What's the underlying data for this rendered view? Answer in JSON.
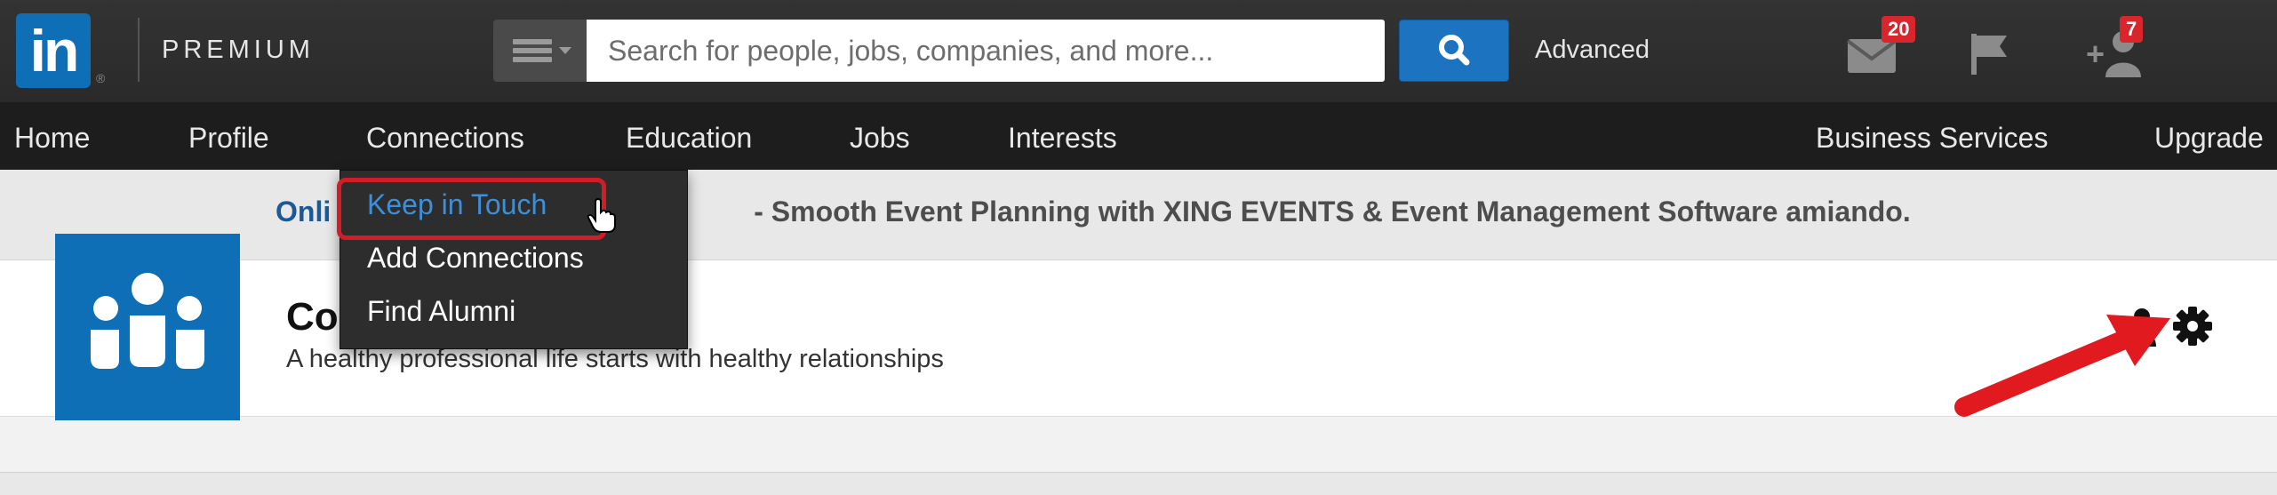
{
  "header": {
    "logo_text": "in",
    "logo_reg": "®",
    "brand_label": "PREMIUM",
    "search": {
      "placeholder": "Search for people, jobs, companies, and more..."
    },
    "advanced_label": "Advanced",
    "messages_count": "20",
    "notifications_count": "7"
  },
  "nav": {
    "items": [
      "Home",
      "Profile",
      "Connections",
      "Education",
      "Jobs",
      "Interests"
    ],
    "right_items": [
      "Business Services",
      "Upgrade"
    ]
  },
  "dropdown": {
    "items": [
      "Keep in Touch",
      "Add Connections",
      "Find Alumni"
    ]
  },
  "ad": {
    "link_text": "Onli",
    "rest_text": "- Smooth Event Planning with XING EVENTS & Event Management Software amiando."
  },
  "page": {
    "title": "Co",
    "tagline": "A healthy professional life starts with healthy relationships"
  },
  "colors": {
    "linkedin_blue": "#0e6fb7",
    "search_button": "#1c74c0",
    "badge_red": "#d8262c",
    "highlight_red": "#d11d25",
    "dropdown_link": "#3e8fd8"
  }
}
